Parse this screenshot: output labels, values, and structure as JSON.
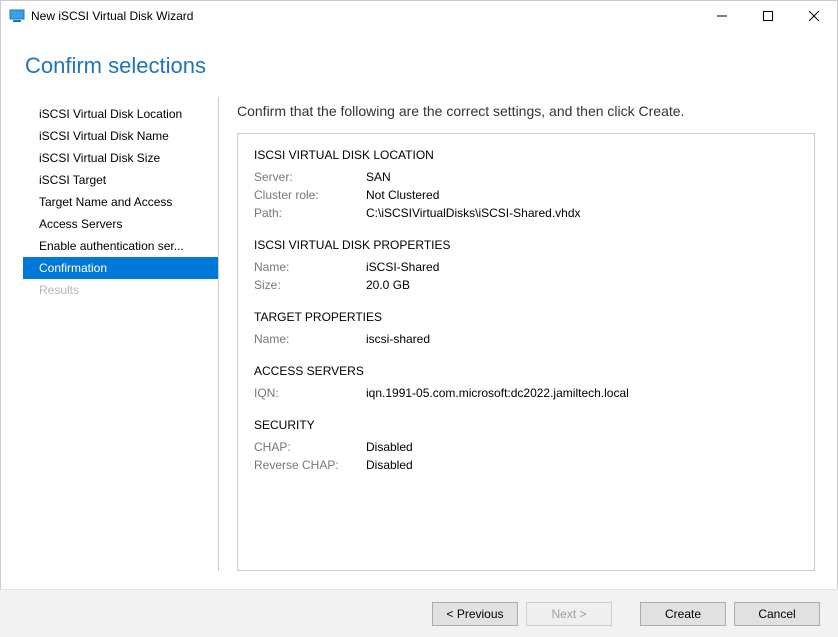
{
  "window": {
    "title": "New iSCSI Virtual Disk Wizard"
  },
  "header": {
    "title": "Confirm selections"
  },
  "nav": {
    "items": [
      {
        "label": "iSCSI Virtual Disk Location",
        "state": "normal"
      },
      {
        "label": "iSCSI Virtual Disk Name",
        "state": "normal"
      },
      {
        "label": "iSCSI Virtual Disk Size",
        "state": "normal"
      },
      {
        "label": "iSCSI Target",
        "state": "normal"
      },
      {
        "label": "Target Name and Access",
        "state": "normal"
      },
      {
        "label": "Access Servers",
        "state": "normal"
      },
      {
        "label": "Enable authentication ser...",
        "state": "normal"
      },
      {
        "label": "Confirmation",
        "state": "selected"
      },
      {
        "label": "Results",
        "state": "disabled"
      }
    ]
  },
  "content": {
    "instruction": "Confirm that the following are the correct settings, and then click Create.",
    "sections": {
      "location": {
        "title": "ISCSI VIRTUAL DISK LOCATION",
        "server_label": "Server:",
        "server_value": "SAN",
        "cluster_label": "Cluster role:",
        "cluster_value": "Not Clustered",
        "path_label": "Path:",
        "path_value": "C:\\iSCSIVirtualDisks\\iSCSI-Shared.vhdx"
      },
      "props": {
        "title": "ISCSI VIRTUAL DISK PROPERTIES",
        "name_label": "Name:",
        "name_value": "iSCSI-Shared",
        "size_label": "Size:",
        "size_value": "20.0 GB"
      },
      "target": {
        "title": "TARGET PROPERTIES",
        "name_label": "Name:",
        "name_value": "iscsi-shared"
      },
      "access": {
        "title": "ACCESS SERVERS",
        "iqn_label": "IQN:",
        "iqn_value": "iqn.1991-05.com.microsoft:dc2022.jamiltech.local"
      },
      "security": {
        "title": "SECURITY",
        "chap_label": "CHAP:",
        "chap_value": "Disabled",
        "rchap_label": "Reverse CHAP:",
        "rchap_value": "Disabled"
      }
    }
  },
  "footer": {
    "previous": "< Previous",
    "next": "Next >",
    "create": "Create",
    "cancel": "Cancel"
  }
}
